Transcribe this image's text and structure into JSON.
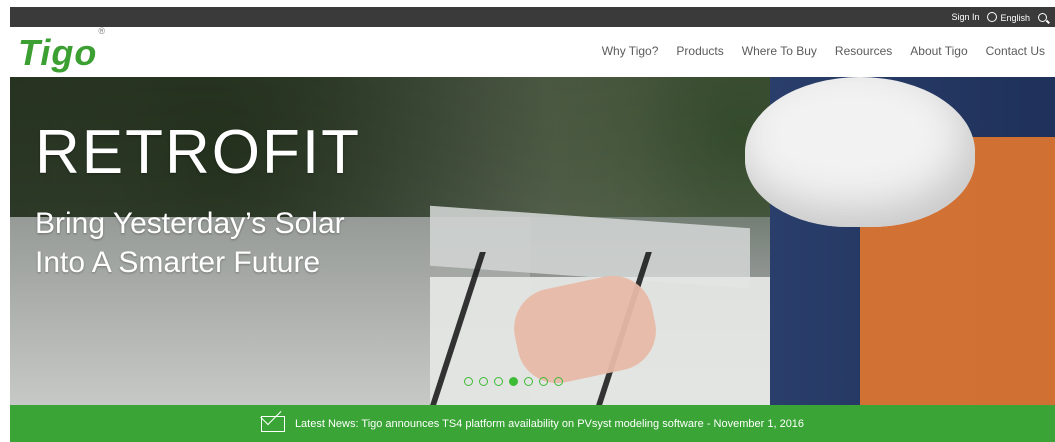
{
  "topbar": {
    "sign_in": "Sign In",
    "language": "English",
    "icons": [
      "globe-icon",
      "search-icon"
    ]
  },
  "brand": {
    "name": "Tigo",
    "trademark": "®",
    "color": "#3b9f32"
  },
  "nav": {
    "items": [
      "Why Tigo?",
      "Products",
      "Where To Buy",
      "Resources",
      "About Tigo",
      "Contact Us"
    ]
  },
  "hero": {
    "title": "RETROFIT",
    "subtitle_line1": "Bring Yesterday’s Solar",
    "subtitle_line2": "Into A Smarter Future",
    "carousel_count": 7,
    "carousel_active_index": 3,
    "accent_color": "#3dbb35"
  },
  "news": {
    "text": "Latest News: Tigo announces TS4 platform availability on PVsyst modeling software - November 1, 2016",
    "icon": "mail-icon",
    "background": "#3aa536"
  }
}
